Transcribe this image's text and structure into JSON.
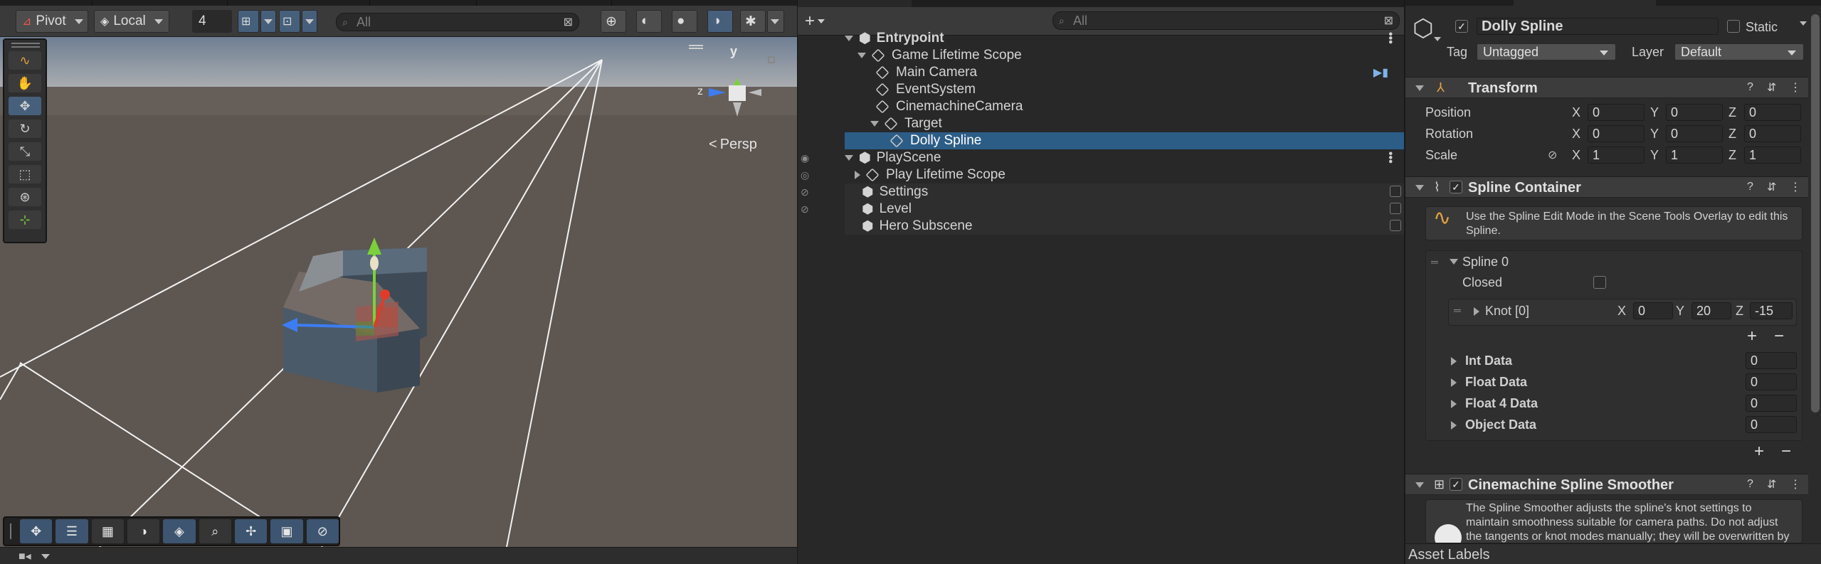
{
  "scene_toolbar": {
    "pivot_label": "Pivot",
    "local_label": "Local",
    "grid_value": "4",
    "search_placeholder": "All"
  },
  "viewport": {
    "projection_label": "Persp",
    "gizmo_y": "y",
    "gizmo_z": "z"
  },
  "hierarchy": {
    "search_placeholder": "All",
    "rows": [
      {
        "label": "Entrypoint"
      },
      {
        "label": "Game Lifetime Scope"
      },
      {
        "label": "Main Camera"
      },
      {
        "label": "EventSystem"
      },
      {
        "label": "CinemachineCamera"
      },
      {
        "label": "Target"
      },
      {
        "label": "Dolly Spline"
      },
      {
        "label": "PlayScene"
      },
      {
        "label": "Play Lifetime Scope"
      },
      {
        "label": "Settings"
      },
      {
        "label": "Level"
      },
      {
        "label": "Hero Subscene"
      }
    ]
  },
  "inspector": {
    "object_name": "Dolly Spline",
    "static_label": "Static",
    "tag_label": "Tag",
    "tag_value": "Untagged",
    "layer_label": "Layer",
    "layer_value": "Default",
    "transform": {
      "title": "Transform",
      "position_label": "Position",
      "rotation_label": "Rotation",
      "scale_label": "Scale",
      "x": "X",
      "y": "Y",
      "z": "Z",
      "position": [
        "0",
        "0",
        "0"
      ],
      "rotation": [
        "0",
        "0",
        "0"
      ],
      "scale": [
        "1",
        "1",
        "1"
      ]
    },
    "spline_container": {
      "title": "Spline Container",
      "help": "Use the Spline Edit Mode in the Scene Tools Overlay to edit this Spline.",
      "spline_label": "Spline 0",
      "closed_label": "Closed",
      "knot_label": "Knot [0]",
      "knot": [
        "0",
        "20",
        "-15"
      ],
      "data_rows": [
        {
          "label": "Int Data",
          "value": "0"
        },
        {
          "label": "Float Data",
          "value": "0"
        },
        {
          "label": "Float 4 Data",
          "value": "0"
        },
        {
          "label": "Object Data",
          "value": "0"
        }
      ]
    },
    "smoother": {
      "title": "Cinemachine Spline Smoother",
      "help": "The Spline Smoother adjusts the spline's knot settings to maintain smoothness suitable for camera paths.  Do not adjust the tangents or knot modes manually; they will be overwritten by"
    },
    "asset_labels": "Asset Labels"
  },
  "colors": {
    "selection": "#2c5d87",
    "active_tool": "#46607c",
    "panel": "#282828"
  }
}
